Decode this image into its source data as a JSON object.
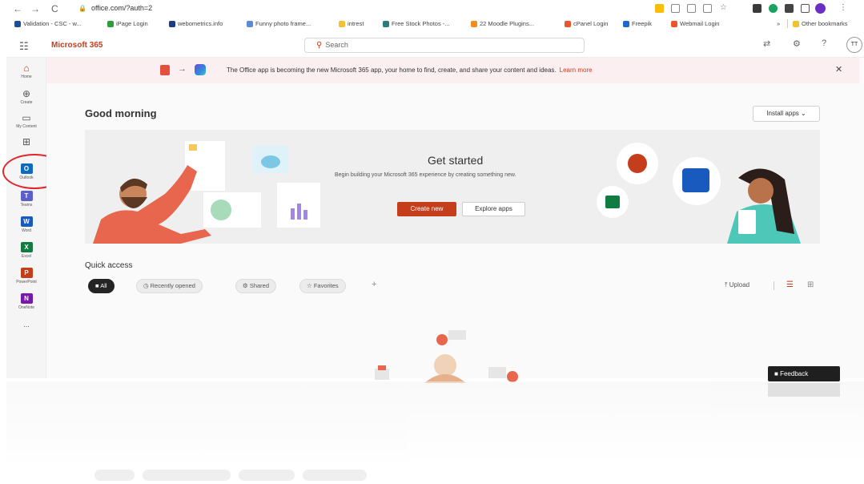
{
  "browser": {
    "nav": {
      "back": "←",
      "forward": "→",
      "reload": "C"
    },
    "url": "office.com/?auth=2",
    "bookmarks": [
      "Validation - CSC - w...",
      "iPage Login",
      "webometrics.info",
      "Funny photo frame...",
      "intrest",
      "Free Stock Photos -...",
      "22 Moodle Plugins...",
      "cPanel Login",
      "Freepik",
      "Webmail Login"
    ],
    "other_bookmarks": "Other bookmarks"
  },
  "header": {
    "brand": "Microsoft 365",
    "search_placeholder": "Search",
    "help": "?",
    "profile_initials": "TT"
  },
  "rail": [
    {
      "label": "Home",
      "icon": "home-icon"
    },
    {
      "label": "Create",
      "icon": "create-icon"
    },
    {
      "label": "My Content",
      "icon": "folder-icon"
    },
    {
      "label": "",
      "icon": "apps-icon"
    },
    {
      "label": "Outlook",
      "icon": "outlook-icon",
      "color": "#0f6cbd",
      "letter": "O"
    },
    {
      "label": "Teams",
      "icon": "teams-icon",
      "color": "#5b5fc7",
      "letter": "T"
    },
    {
      "label": "Word",
      "icon": "word-icon",
      "color": "#185abd",
      "letter": "W"
    },
    {
      "label": "Excel",
      "icon": "excel-icon",
      "color": "#107c41",
      "letter": "X"
    },
    {
      "label": "PowerPoint",
      "icon": "powerpoint-icon",
      "color": "#c43e1c",
      "letter": "P"
    },
    {
      "label": "OneNote",
      "icon": "onenote-icon",
      "color": "#7719aa",
      "letter": "N"
    },
    {
      "label": "...",
      "icon": "more-icon"
    }
  ],
  "banner": {
    "message": "The Office app is becoming the new Microsoft 365 app, your home to find, create, and share your content and ideas.",
    "link": "Learn more",
    "close": "✕"
  },
  "main": {
    "greeting": "Good morning",
    "install_apps": "Install apps",
    "hero": {
      "title": "Get started",
      "description": "Begin building your Microsoft 365 experience by creating something new.",
      "create_new": "Create new",
      "explore_apps": "Explore apps"
    },
    "quick_access": {
      "title": "Quick access",
      "filters": [
        "All",
        "Recently opened",
        "Shared",
        "Favorites"
      ],
      "add": "+",
      "upload": "Upload"
    },
    "feedback": "Feedback"
  },
  "colors": {
    "accent": "#c43e1c",
    "annotation_circle": "#e1262d"
  }
}
